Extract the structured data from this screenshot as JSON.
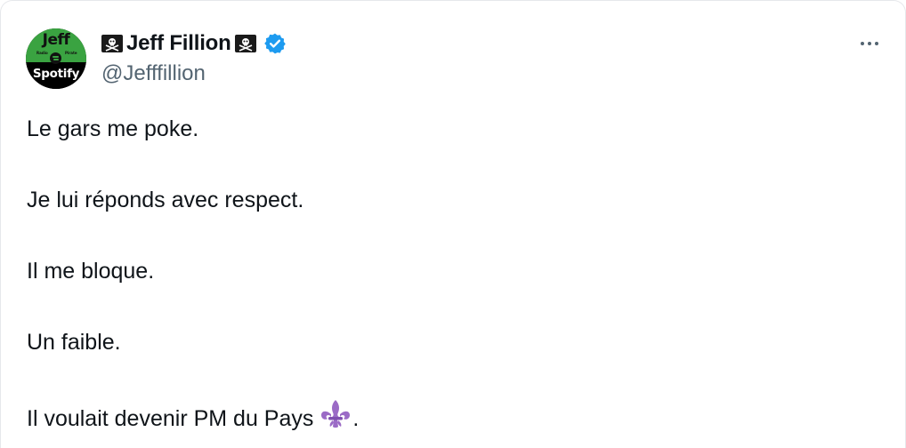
{
  "author": {
    "display_name": "Jeff Fillion",
    "handle": "@Jefffillion",
    "verified": true,
    "name_icons": [
      "pirate-flag-icon",
      "pirate-flag-icon"
    ],
    "avatar": {
      "top_text": "Jeff",
      "small_left": "Radio",
      "small_right": "Pirate",
      "bottom_text": "Spotify",
      "colors": {
        "top": "#3aa341",
        "bottom": "#000000"
      }
    }
  },
  "tweet": {
    "lines": [
      "Le gars me poke.",
      "Je lui réponds avec respect.",
      "Il me bloque.",
      "Un faible.",
      "Il voulait devenir PM du Pays"
    ],
    "trailing_emoji": "fleur-de-lis-icon",
    "trailing_text": "."
  },
  "colors": {
    "text": "#0f1419",
    "secondary": "#536471",
    "verified": "#1d9bf0",
    "fleur": "#9b6bc6"
  }
}
